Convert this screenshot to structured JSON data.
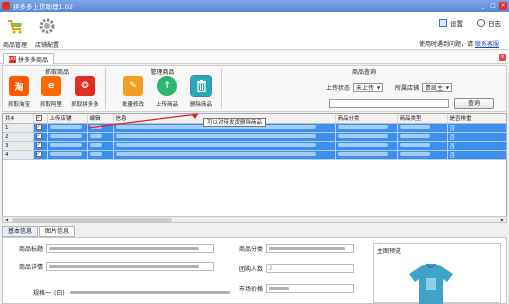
{
  "window": {
    "title": "拼多多上货助理1.02",
    "controls": [
      "_",
      "□",
      "×"
    ]
  },
  "toolbar": {
    "items": [
      {
        "label": "商品管理",
        "icon": "cart-icon"
      },
      {
        "label": "店铺配置",
        "icon": "gear-icon"
      }
    ],
    "right": [
      {
        "label": "设置",
        "icon": "settings-icon"
      },
      {
        "label": "日志",
        "icon": "log-icon"
      }
    ],
    "help_text": "使用时遇到问题，请",
    "help_link": "联系客服"
  },
  "tab": {
    "label": "拼多多商品",
    "badge": "pdd"
  },
  "ribbon": {
    "groups": [
      {
        "title": "抓取商品"
      },
      {
        "title": "管理商品"
      },
      {
        "title": "商品查询"
      }
    ],
    "buttons": [
      {
        "label": "抓取淘宝",
        "glyph": "淘",
        "color": "#ff5a00"
      },
      {
        "label": "抓取阿里",
        "glyph": "e",
        "color": "#ff6a00"
      },
      {
        "label": "抓取拼多多",
        "glyph": "❂",
        "color": "#e02e24"
      },
      {
        "label": "批量修改",
        "glyph": "✎",
        "color": "#f0a020"
      },
      {
        "label": "上传商品",
        "glyph": "↑",
        "color": "#2bb673"
      },
      {
        "label": "删除商品",
        "glyph": "🗑",
        "color": "#2aa8b4"
      }
    ],
    "query": {
      "upload_status_label": "上传状态",
      "upload_status_value": "未上传",
      "store_label": "所属店铺",
      "store_value": "贵凯主",
      "search_button": "查询"
    }
  },
  "tooltip": "可以对待发货删除商品",
  "grid": {
    "columns": [
      "共4",
      "",
      "上传店铺",
      "编辑",
      "信息",
      "商品分类",
      "商品类型",
      "是否排重"
    ],
    "rows": [
      {
        "num": "1",
        "checked": "✓",
        "category_hint": "",
        "type_hint": "",
        "dup": "否"
      },
      {
        "num": "2",
        "checked": "✓",
        "category_hint": "",
        "type_hint": "",
        "dup": "否"
      },
      {
        "num": "3",
        "checked": "✓",
        "category_hint": "",
        "type_hint": "",
        "dup": "否"
      },
      {
        "num": "4",
        "checked": "✓",
        "category_hint": "",
        "type_hint": "",
        "dup": "否"
      }
    ]
  },
  "detail": {
    "tabs": [
      "基本信息",
      "图片信息"
    ],
    "fields": {
      "title_label": "商品标题",
      "detail_label": "商品详情",
      "spec_label": "规格一",
      "spec_value": "(白)",
      "category_label": "商品分类",
      "group_label": "团购人数",
      "group_value": "2",
      "market_label": "市场价格",
      "main_image_label": "主图预览"
    }
  }
}
